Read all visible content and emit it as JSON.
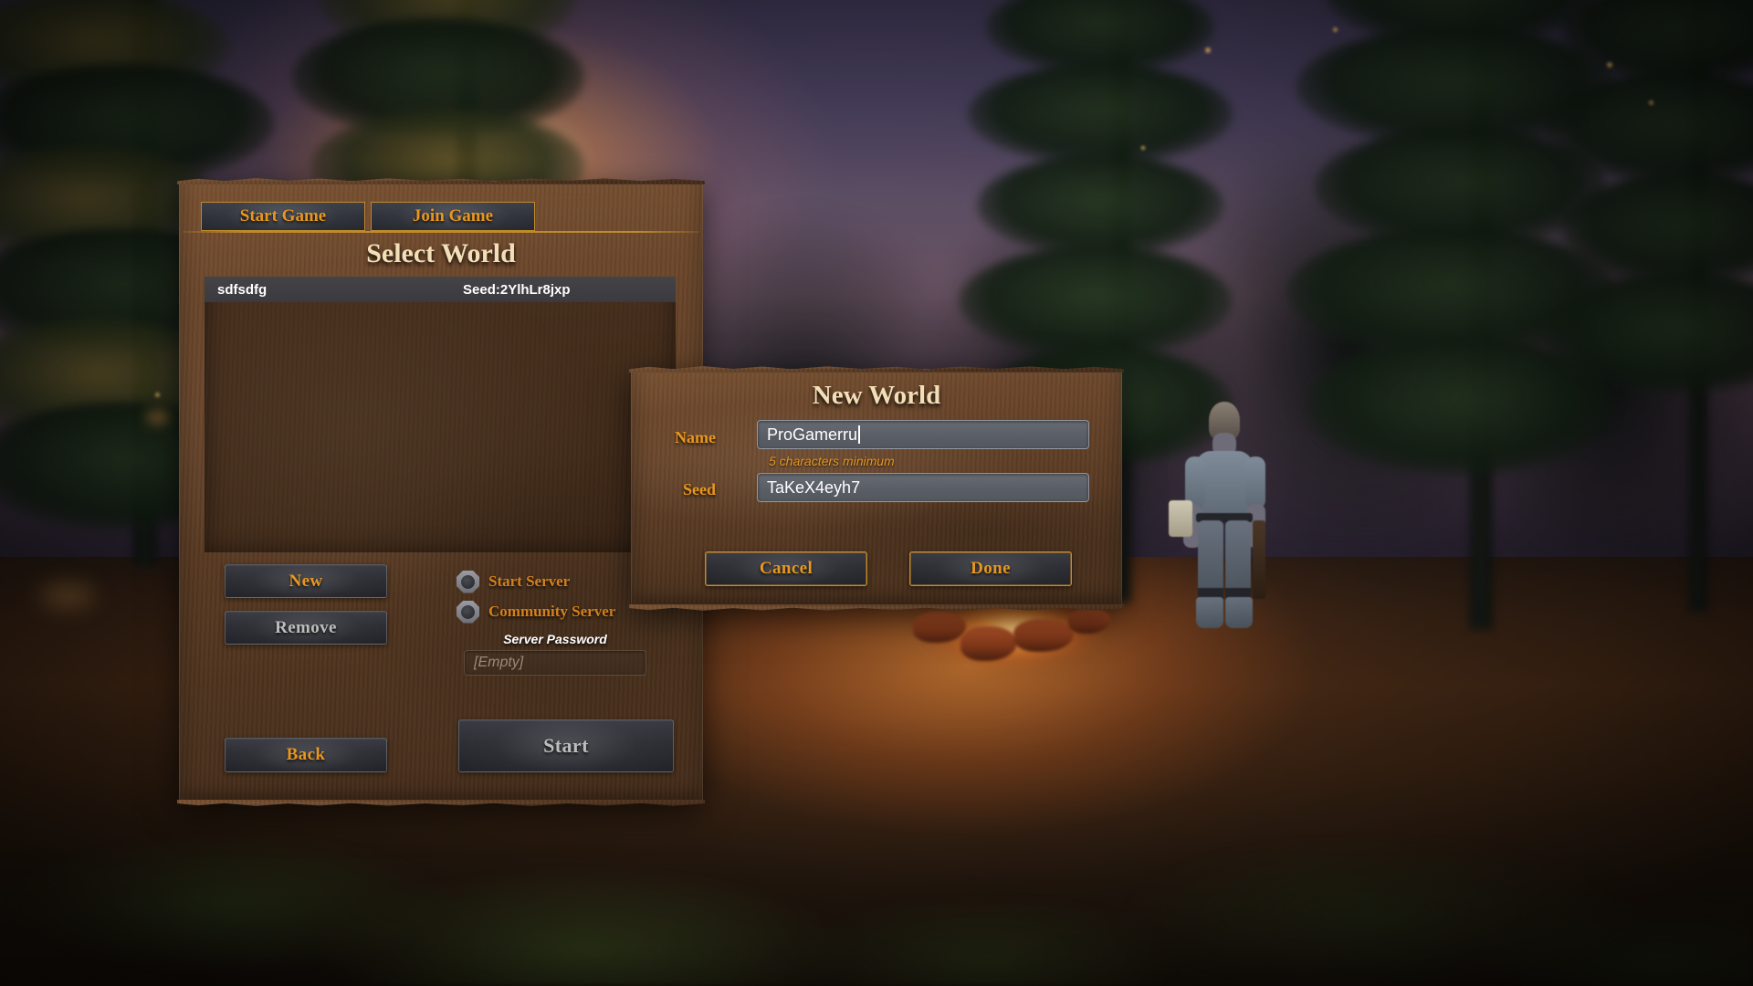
{
  "colors": {
    "gold_text": "#e8971f",
    "gold_border": "#c08a2c",
    "title_cream": "#f2dfb8",
    "disabled_gray": "#bdbdbd",
    "wood_brown": "#5c3c24",
    "input_slate": "#5a5e66"
  },
  "scene": {
    "description": "blurred-pine-forest-dusk-campfire",
    "character": "viking-player-character"
  },
  "main_panel": {
    "tabs": [
      {
        "label": "Start Game",
        "active": true
      },
      {
        "label": "Join Game",
        "active": false
      }
    ],
    "title": "Select World",
    "world_list": {
      "rows": [
        {
          "name": "sdfsdfg",
          "seed": "Seed:2YlhLr8jxp",
          "selected": true
        }
      ]
    },
    "buttons": {
      "new": "New",
      "remove": "Remove",
      "back": "Back",
      "start": "Start"
    },
    "server_options": [
      {
        "label": "Start Server",
        "checked": false
      },
      {
        "label": "Community Server",
        "checked": false
      }
    ],
    "server_password": {
      "label": "Server Password",
      "value": "",
      "placeholder": "[Empty]"
    }
  },
  "new_world_dialog": {
    "title": "New World",
    "name_field": {
      "label": "Name",
      "value": "ProGamerru",
      "hint": "5 characters minimum"
    },
    "seed_field": {
      "label": "Seed",
      "value": "TaKeX4eyh7"
    },
    "buttons": {
      "cancel": "Cancel",
      "done": "Done"
    }
  }
}
